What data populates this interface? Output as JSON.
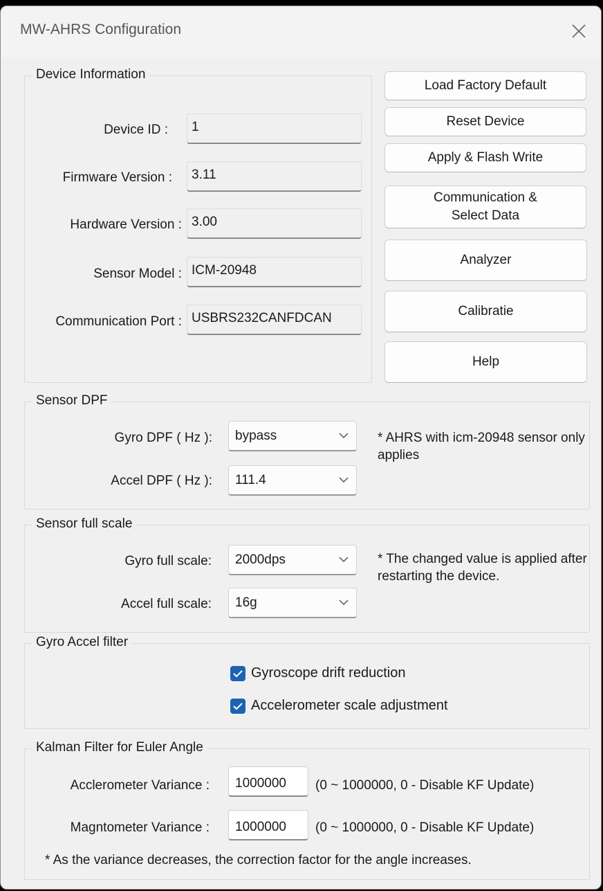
{
  "window": {
    "title": "MW-AHRS Configuration"
  },
  "device_info": {
    "title": "Device Information",
    "fields": [
      {
        "label": "Device ID :",
        "value": "1"
      },
      {
        "label": "Firmware Version :",
        "value": "3.11"
      },
      {
        "label": "Hardware Version :",
        "value": "3.00"
      },
      {
        "label": "Sensor Model :",
        "value": "ICM-20948"
      },
      {
        "label": "Communication Port :",
        "value": "USBRS232CANFDCAN"
      }
    ]
  },
  "buttons": {
    "load_factory_default": "Load Factory Default",
    "reset_device": "Reset Device",
    "apply_flash_write": "Apply & Flash Write",
    "communication_select_data": "Communication &\nSelect Data",
    "analyzer": "Analyzer",
    "calibratie": "Calibratie",
    "help": "Help"
  },
  "sensor_dpf": {
    "title": "Sensor DPF",
    "gyro_label": "Gyro DPF ( Hz ):",
    "gyro_value": "bypass",
    "accel_label": "Accel DPF ( Hz ):",
    "accel_value": "111.4",
    "note": "* AHRS with icm-20948 sensor only applies"
  },
  "sensor_full_scale": {
    "title": "Sensor full scale",
    "gyro_label": "Gyro full scale:",
    "gyro_value": "2000dps",
    "accel_label": "Accel full scale:",
    "accel_value": "16g",
    "note": "* The changed value is applied after restarting the device."
  },
  "gyro_accel_filter": {
    "title": "Gyro Accel filter",
    "gyro_drift_label": "Gyroscope drift reduction",
    "gyro_drift_checked": true,
    "accel_scale_label": "Accelerometer scale adjustment",
    "accel_scale_checked": true
  },
  "kalman": {
    "title": "Kalman Filter for Euler Angle",
    "accel_label": "Acclerometer Variance :",
    "accel_value": "1000000",
    "accel_range": "(0 ~ 1000000, 0 - Disable KF Update)",
    "mag_label": "Magntometer Variance :",
    "mag_value": "1000000",
    "mag_range": "(0 ~ 1000000, 0 - Disable KF Update)",
    "footnote": "* As the variance decreases, the correction factor for the angle increases."
  },
  "colors": {
    "window_bg": "#f0f0f0",
    "checkbox_accent": "#1e63b3",
    "group_border": "#d9d9d9"
  },
  "icons": {
    "close": "close-icon",
    "dropdown": "chevron-down-icon",
    "check": "checkmark-icon"
  }
}
